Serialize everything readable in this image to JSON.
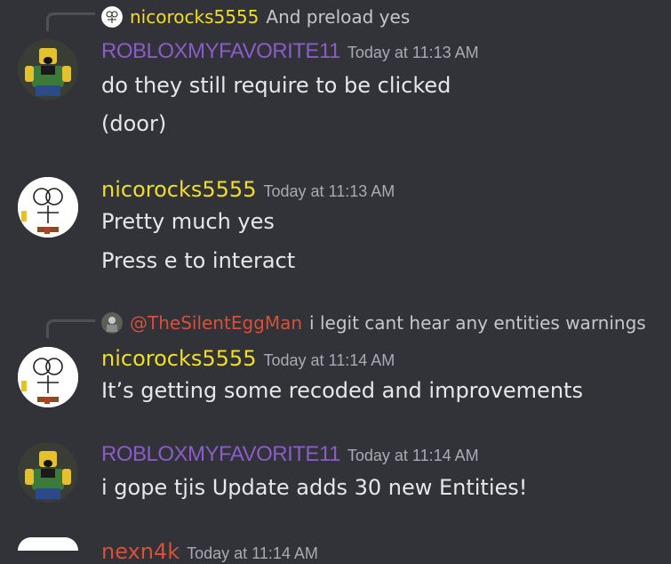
{
  "messages": [
    {
      "reply": {
        "author": "nicorocks5555",
        "text": "And preload yes"
      },
      "author": "ROBLOXMYFAVORITE11",
      "timestamp": "Today at 11:13 AM",
      "lines": [
        "do they still require to be clicked",
        "(door)"
      ]
    },
    {
      "author": "nicorocks5555",
      "timestamp": "Today at 11:13 AM",
      "lines": [
        "Pretty much yes",
        "Press e to interact"
      ]
    },
    {
      "reply": {
        "author": "@TheSilentEggMan",
        "text": "i legit cant hear any entities warnings"
      },
      "author": "nicorocks5555",
      "timestamp": "Today at 11:14 AM",
      "lines": [
        "It’s getting some recoded and improvements"
      ]
    },
    {
      "author": "ROBLOXMYFAVORITE11",
      "timestamp": "Today at 11:14 AM",
      "lines": [
        "i gope tjis Update adds 30 new Entities!"
      ]
    },
    {
      "author": "nexn4k",
      "timestamp": "Today at 11:14 AM",
      "lines": []
    }
  ],
  "colors": {
    "background": "#313338",
    "author_purple": "#8b5cc7",
    "author_yellow": "#f1dd2a",
    "mention_red": "#d8503a",
    "timestamp": "#a8abb2"
  },
  "icons": {
    "roblox_avatar": "roblox-character-avatar-icon",
    "spong_avatar": "drawn-face-sponge-avatar-icon"
  }
}
